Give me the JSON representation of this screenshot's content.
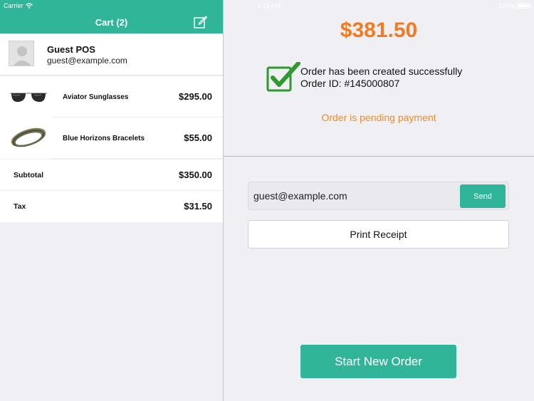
{
  "status_bar": {
    "carrier": "Carrier",
    "time": "9:16 AM",
    "battery": "100%"
  },
  "cart": {
    "title": "Cart (2)",
    "customer": {
      "name": "Guest POS",
      "email": "guest@example.com"
    },
    "items": [
      {
        "name": "Aviator Sunglasses",
        "price": "$295.00",
        "icon": "sunglasses-thumbnail"
      },
      {
        "name": "Blue Horizons Bracelets",
        "price": "$55.00",
        "icon": "bracelets-thumbnail"
      }
    ],
    "subtotal": {
      "label": "Subtotal",
      "value": "$350.00"
    },
    "tax": {
      "label": "Tax",
      "value": "$31.50"
    }
  },
  "order": {
    "total": "$381.50",
    "success_message": "Order has been created successfully",
    "order_id": "Order ID: #145000807",
    "pending_message": "Order is pending payment"
  },
  "receipt": {
    "email_value": "guest@example.com",
    "send_label": "Send",
    "print_label": "Print Receipt"
  },
  "actions": {
    "start_new_order_label": "Start New Order"
  },
  "colors": {
    "accent": "#31b598",
    "total": "#f57a1f",
    "pending": "#f58a24",
    "check": "#2e9a2e"
  }
}
